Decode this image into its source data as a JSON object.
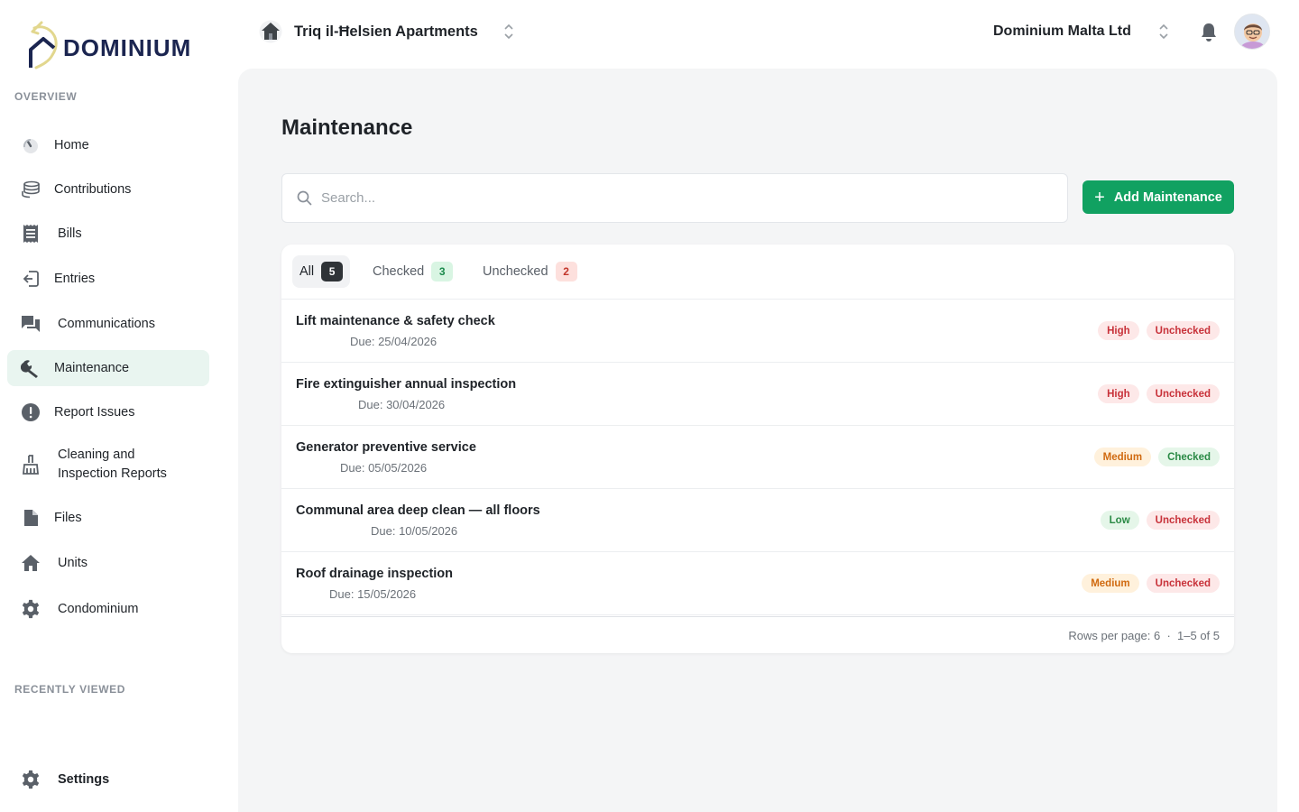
{
  "brand": {
    "name": "DOMINIUM"
  },
  "sidebar": {
    "overview_label": "OVERVIEW",
    "recent_label": "RECENTLY VIEWED",
    "items": [
      {
        "label": "Home",
        "icon": "dashboard-gauge-icon"
      },
      {
        "label": "Contributions",
        "icon": "coins-stack-icon"
      },
      {
        "label": "Bills",
        "icon": "receipt-icon"
      },
      {
        "label": "Entries",
        "icon": "entry-login-icon"
      },
      {
        "label": "Communications",
        "icon": "chat-bubbles-icon"
      },
      {
        "label": "Maintenance",
        "icon": "wrench-icon",
        "active": true
      },
      {
        "label": "Report Issues",
        "icon": "alert-circle-icon"
      },
      {
        "label": "Cleaning and Inspection Reports",
        "icon": "broom-icon"
      },
      {
        "label": "Files",
        "icon": "file-icon"
      },
      {
        "label": "Units",
        "icon": "house-icon"
      },
      {
        "label": "Condominium",
        "icon": "gear-icon"
      }
    ],
    "settings_label": "Settings"
  },
  "topbar": {
    "property_name": "Triq il-Ħelsien Apartments",
    "organization_name": "Dominium Malta Ltd"
  },
  "main": {
    "title": "Maintenance",
    "search_placeholder": "Search...",
    "add_button_label": "Add Maintenance",
    "tabs": [
      {
        "label": "All",
        "count": "5"
      },
      {
        "label": "Checked",
        "count": "3"
      },
      {
        "label": "Unchecked",
        "count": "2"
      }
    ],
    "rows": [
      {
        "title": "Lift maintenance & safety check",
        "due": "Due: 25/04/2026",
        "priority": "High",
        "status": "Unchecked"
      },
      {
        "title": "Fire extinguisher annual inspection",
        "due": "Due: 30/04/2026",
        "priority": "High",
        "status": "Unchecked"
      },
      {
        "title": "Generator preventive service",
        "due": "Due: 05/05/2026",
        "priority": "Medium",
        "status": "Checked"
      },
      {
        "title": "Communal area deep clean — all floors",
        "due": "Due: 10/05/2026",
        "priority": "Low",
        "status": "Unchecked"
      },
      {
        "title": "Roof drainage inspection",
        "due": "Due: 15/05/2026",
        "priority": "Medium",
        "status": "Unchecked"
      }
    ],
    "pager": "Rows per page: 6  ·  1–5 of 5"
  },
  "colors": {
    "accent": "#11a161",
    "active_nav_bg": "#e9f5f0",
    "brand_navy": "#1b2550",
    "brand_gold": "#e2d78e"
  }
}
